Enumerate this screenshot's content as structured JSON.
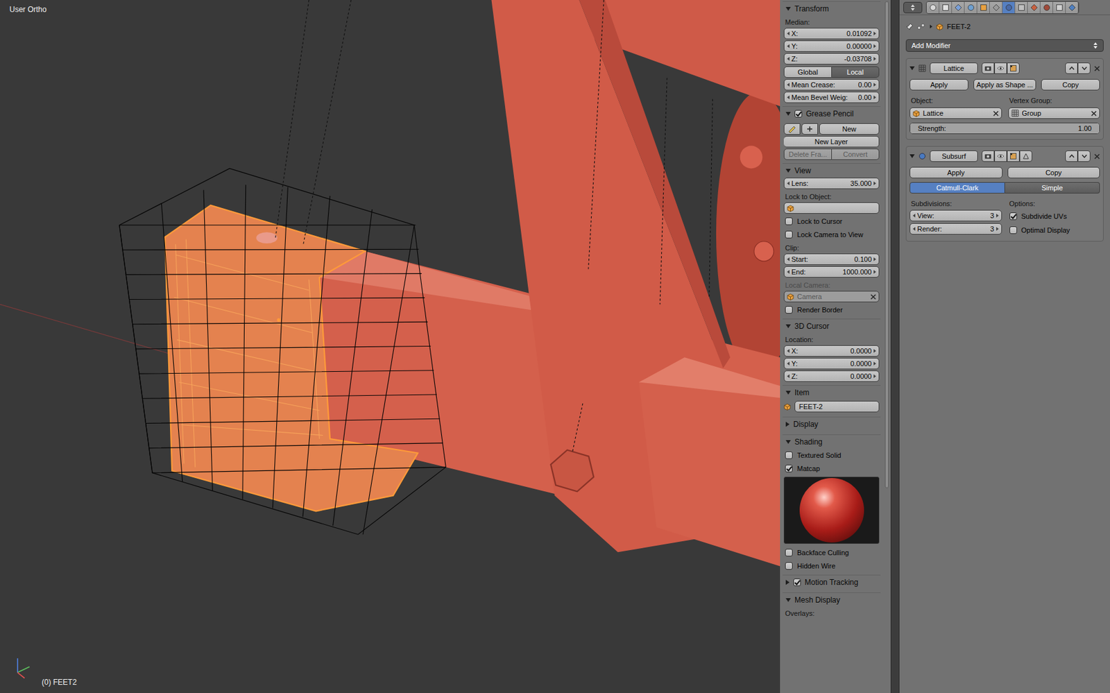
{
  "viewport": {
    "view_label": "User Ortho",
    "object_label": "(0) FEET2"
  },
  "n_panel": {
    "sections": [
      {
        "title": "Transform",
        "expanded": true,
        "rows": [
          {
            "kind": "caption",
            "label": "Median:",
            "disabled": false
          },
          {
            "kind": "number",
            "label": "X:",
            "value": "0.01092"
          },
          {
            "kind": "number",
            "label": "Y:",
            "value": "0.00000"
          },
          {
            "kind": "number",
            "label": "Z:",
            "value": "-0.03708"
          },
          {
            "kind": "toggle",
            "options": [
              {
                "label": "Global",
                "selected": false
              },
              {
                "label": "Local",
                "selected": true
              }
            ]
          },
          {
            "kind": "number",
            "label": "Mean Crease:",
            "value": "0.00"
          },
          {
            "kind": "number",
            "label": "Mean Bevel Weig:",
            "value": "0.00"
          }
        ]
      },
      {
        "title": "Grease Pencil",
        "expanded": true,
        "checked": true,
        "rows": [
          {
            "kind": "pencil",
            "label": "New"
          },
          {
            "kind": "button",
            "label": "New Layer",
            "disabled": false
          },
          {
            "kind": "button-pair",
            "buttons": [
              {
                "label": "Delete Fra...",
                "disabled": true
              },
              {
                "label": "Convert",
                "disabled": true
              }
            ]
          }
        ]
      },
      {
        "title": "View",
        "expanded": true,
        "rows": [
          {
            "kind": "number",
            "label": "Lens:",
            "value": "35.000"
          },
          {
            "kind": "caption",
            "label": "Lock to Object:",
            "disabled": false
          },
          {
            "kind": "object-field",
            "value": "",
            "disabled": false,
            "clearable": false
          },
          {
            "kind": "checkbox",
            "label": "Lock to Cursor",
            "checked": false
          },
          {
            "kind": "checkbox",
            "label": "Lock Camera to View",
            "checked": false
          },
          {
            "kind": "caption",
            "label": "Clip:",
            "disabled": false
          },
          {
            "kind": "number",
            "label": "Start:",
            "value": "0.100"
          },
          {
            "kind": "number",
            "label": "End:",
            "value": "1000.000"
          },
          {
            "kind": "caption",
            "label": "Local Camera:",
            "disabled": true
          },
          {
            "kind": "object-field",
            "value": "Camera",
            "disabled": true,
            "clearable": true
          },
          {
            "kind": "checkbox",
            "label": "Render Border",
            "checked": false
          }
        ]
      },
      {
        "title": "3D Cursor",
        "expanded": true,
        "rows": [
          {
            "kind": "caption",
            "label": "Location:",
            "disabled": false
          },
          {
            "kind": "number",
            "label": "X:",
            "value": "0.0000"
          },
          {
            "kind": "number",
            "label": "Y:",
            "value": "0.0000"
          },
          {
            "kind": "number",
            "label": "Z:",
            "value": "0.0000"
          }
        ]
      },
      {
        "title": "Item",
        "expanded": true,
        "rows": [
          {
            "kind": "name-field",
            "value": "FEET-2"
          }
        ]
      },
      {
        "title": "Display",
        "expanded": false,
        "rows": []
      },
      {
        "title": "Shading",
        "expanded": true,
        "rows": [
          {
            "kind": "checkbox",
            "label": "Textured Solid",
            "checked": false
          },
          {
            "kind": "checkbox",
            "label": "Matcap",
            "checked": true
          },
          {
            "kind": "matcap"
          },
          {
            "kind": "checkbox",
            "label": "Backface Culling",
            "checked": false
          },
          {
            "kind": "checkbox",
            "label": "Hidden Wire",
            "checked": false
          }
        ]
      },
      {
        "title": "Motion Tracking",
        "expanded": false,
        "checked": true,
        "rows": []
      },
      {
        "title": "Mesh Display",
        "expanded": true,
        "rows": [
          {
            "kind": "caption",
            "label": "Overlays:",
            "disabled": false
          }
        ]
      }
    ]
  },
  "properties": {
    "context_tabs": [
      {
        "selected": false
      },
      {
        "selected": false
      },
      {
        "selected": false
      },
      {
        "selected": false
      },
      {
        "selected": false
      },
      {
        "selected": false
      },
      {
        "selected": true
      },
      {
        "selected": false
      },
      {
        "selected": false
      },
      {
        "selected": false
      },
      {
        "selected": false
      },
      {
        "selected": false
      }
    ],
    "breadcrumb": "FEET-2",
    "add_modifier": "Add Modifier",
    "modifiers": [
      {
        "kind": "lattice",
        "name": "Lattice",
        "expanded": true,
        "actions": [
          "Apply",
          "Apply as Shape ...",
          "Copy"
        ],
        "object_label": "Object:",
        "object": "Lattice",
        "vertex_group_label": "Vertex Group:",
        "vertex_group": "Group",
        "strength_label": "Strength:",
        "strength": "1.00",
        "strength_level": 1.0
      },
      {
        "kind": "subsurf",
        "name": "Subsurf",
        "expanded": true,
        "actions": [
          "Apply",
          "Copy"
        ],
        "algorithms": [
          {
            "label": "Catmull-Clark",
            "selected": true
          },
          {
            "label": "Simple",
            "selected": false
          }
        ],
        "subdivisions_label": "Subdivisions:",
        "levels": [
          {
            "label": "View:",
            "value": "3"
          },
          {
            "label": "Render:",
            "value": "3"
          }
        ],
        "options_label": "Options:",
        "options": [
          {
            "label": "Subdivide UVs",
            "checked": true
          },
          {
            "label": "Optimal Display",
            "checked": false
          }
        ]
      }
    ]
  }
}
